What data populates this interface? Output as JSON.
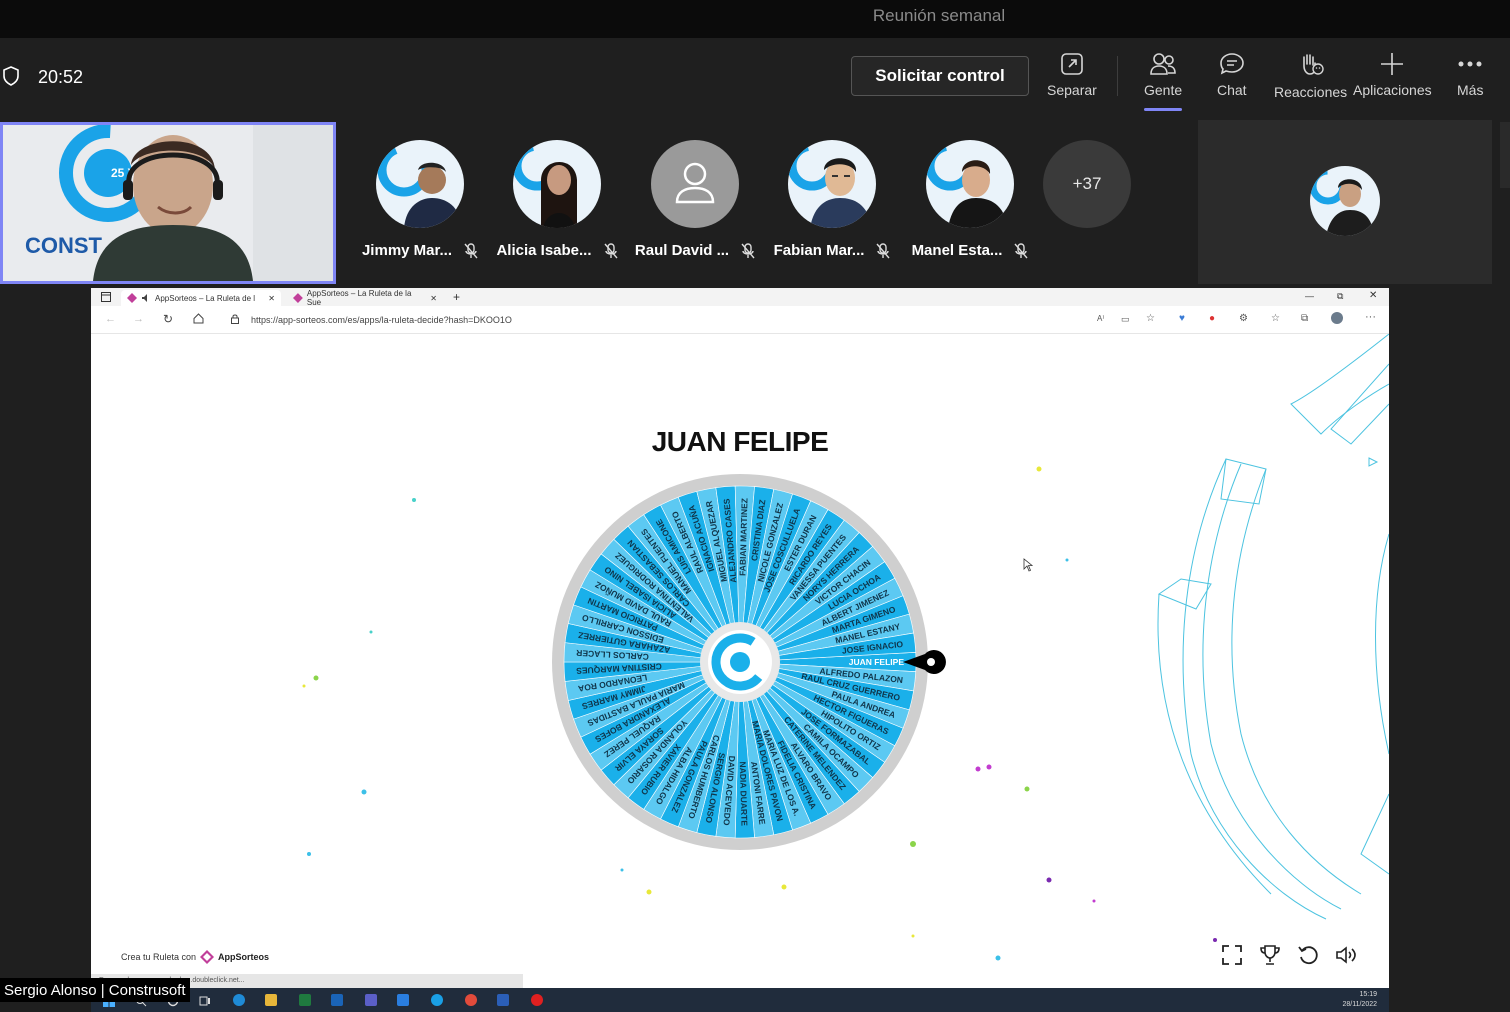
{
  "window": {
    "title": "Reunión semanal"
  },
  "toolbar": {
    "clock": "20:52",
    "request_control": "Solicitar control",
    "separar": "Separar",
    "gente": "Gente",
    "chat": "Chat",
    "reacciones": "Reacciones",
    "aplicaciones": "Aplicaciones",
    "mas": "Más"
  },
  "participants": [
    {
      "name": "Jimmy Mar...",
      "muted": true
    },
    {
      "name": "Alicia Isabe...",
      "muted": true
    },
    {
      "name": "Raul David ...",
      "muted": true
    },
    {
      "name": "Fabian Mar...",
      "muted": true
    },
    {
      "name": "Manel Esta...",
      "muted": true
    }
  ],
  "more_participants": "+37",
  "presenter_label": "Sergio Alonso | Construsoft",
  "browser": {
    "tab1": "AppSorteos – La Ruleta de l",
    "tab2": "AppSorteos – La Ruleta de la Sue",
    "url": "https://app-sorteos.com/es/apps/la-ruleta-decide?hash=DKOO1O",
    "status_url": "Esperando a securepubads.g.doubleclick.net...",
    "winner": "JUAN FELIPE",
    "credit_prefix": "Crea tu Ruleta con",
    "credit_brand": "AppSorteos",
    "wheel_names": [
      "JUAN FELIPE",
      "ALFREDO PALAZON",
      "RAUL CRUZ GUERRERO",
      "PAULA ANDREA",
      "HECTOR FIGUERAS",
      "HIPOLITO ORTIZ",
      "JOSE FORMAZABAL",
      "CAMILA OCAMPO",
      "CATERINE MELENDEZ",
      "ALVARO BRAVO",
      "FIDELIA CRISTINA",
      "MARIA LUZ DE LOS A.",
      "MARIA DOLORES PAVON",
      "ANTONI FARRE",
      "NADIA DUARTE",
      "DAVID ACEVEDO",
      "SERGIO ALONSO",
      "CARLOS HUMBERTO",
      "PAULA GONZALEZ",
      "ALBA HIDALGO",
      "XAVIER RUBIO",
      "YOLANDA ROSARIO",
      "SORAYA ELVIR",
      "RAQUEL PEREZ",
      "ALEXANDRA BOFES",
      "MARIA PAULA BASTIDAS",
      "JIMMY MARRES",
      "LEONARDO ROA",
      "CRISTINA MARQUES",
      "CARLOS LLACER",
      "AZAHARA GUTIERREZ",
      "EDISSON CARRILLO",
      "PATRICIO MARTIN",
      "RAUL DAVID MUÑOZ",
      "ALICIA ISABEL NINO",
      "VALENTINA RODRIGUEZ",
      "CARLOS SEBASTIAN",
      "MANUEL FUENTES",
      "LUIS AMICONE",
      "RAUL ALBERTO",
      "IGNACIO ACUÑA",
      "MIGUEL ALQUEZAR",
      "ALEJANDRO CASES",
      "FABIAN MARTINEZ",
      "CRISTINA DIAZ",
      "NICOLE GONZALEZ",
      "JOSE COSCULLUELA",
      "ESTER DURAN",
      "RICARDO REYES",
      "VANESSA PUENTES",
      "NORYS HERRERA",
      "VICTOR CHACIN",
      "LUCIA OCHOA",
      "ALBERT JIMENEZ",
      "MARTA GIMENO",
      "MANEL ESTANY",
      "JOSE IGNACIO"
    ],
    "taskbar_time": "15:19",
    "taskbar_date": "28/11/2022"
  }
}
